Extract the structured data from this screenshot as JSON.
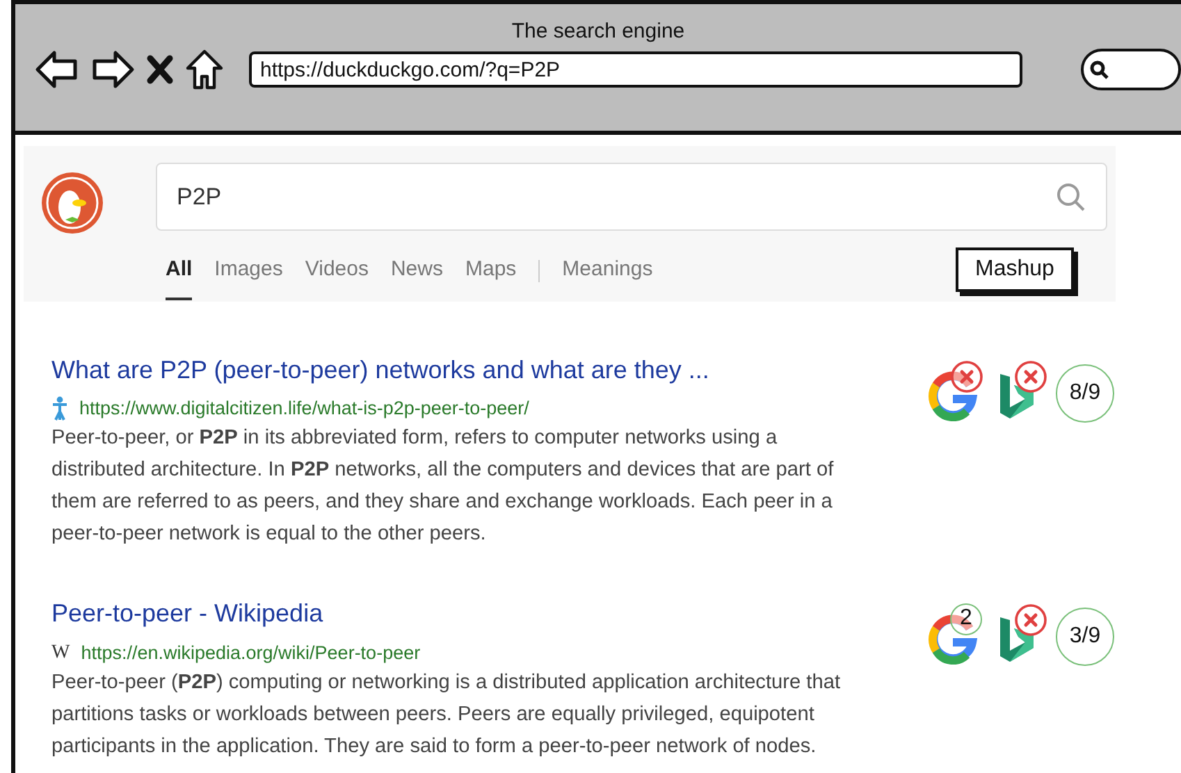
{
  "window": {
    "title": "The search engine",
    "url": "https://duckduckgo.com/?q=P2P"
  },
  "search": {
    "value": "P2P"
  },
  "tabs": [
    {
      "label": "All",
      "selected": true
    },
    {
      "label": "Images",
      "selected": false
    },
    {
      "label": "Videos",
      "selected": false
    },
    {
      "label": "News",
      "selected": false
    },
    {
      "label": "Maps",
      "selected": false
    },
    {
      "label": "Meanings",
      "selected": false
    }
  ],
  "mashup_button": "Mashup",
  "results": [
    {
      "title": "What are P2P (peer-to-peer) networks and what are they ...",
      "site_icon": {
        "kind": "figure"
      },
      "url": "https://www.digitalcitizen.life/what-is-p2p-peer-to-peer/",
      "snippet": "Peer-to-peer, or **P2P** in its abbreviated form, refers to computer networks using a distributed architecture. In **P2P** networks, all the computers and devices that are part of them are referred to as peers, and they share and exchange workloads. Each peer in a peer-to-peer network is equal to the other peers.",
      "engines": [
        {
          "kind": "google",
          "found": false
        },
        {
          "kind": "bing",
          "found": false
        }
      ],
      "score": "8/9"
    },
    {
      "title": "Peer-to-peer - Wikipedia",
      "site_icon": {
        "kind": "letter",
        "text": "W"
      },
      "url": "https://en.wikipedia.org/wiki/Peer-to-peer",
      "snippet": "Peer-to-peer (**P2P**) computing or networking is a distributed application architecture that partitions tasks or workloads between peers. Peers are equally privileged, equipotent participants in the application. They are said to form a peer-to-peer network of nodes.",
      "engines": [
        {
          "kind": "google",
          "found": true,
          "rank": "2"
        },
        {
          "kind": "bing",
          "found": false
        }
      ],
      "score": "3/9"
    }
  ]
}
